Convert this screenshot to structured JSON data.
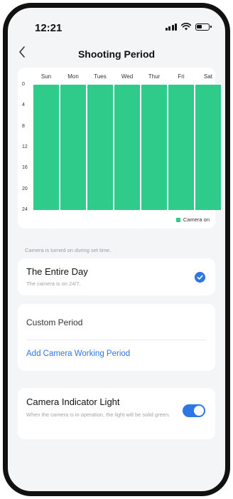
{
  "status_bar": {
    "time": "12:21",
    "icons": [
      "signal-icon",
      "wifi-icon",
      "battery-icon"
    ]
  },
  "header": {
    "title": "Shooting Period",
    "back_icon": "chevron-left-icon"
  },
  "schedule_chart": {
    "days": [
      "Sun",
      "Mon",
      "Tues",
      "Wed",
      "Thur",
      "Fri",
      "Sat"
    ],
    "hour_ticks": [
      "0",
      "4",
      "8",
      "12",
      "16",
      "20",
      "24"
    ],
    "legend_label": "Camera on",
    "bar_color": "#2ecb8a",
    "periods": [
      {
        "day": "Sun",
        "start": 0,
        "end": 24
      },
      {
        "day": "Mon",
        "start": 0,
        "end": 24
      },
      {
        "day": "Tues",
        "start": 0,
        "end": 24
      },
      {
        "day": "Wed",
        "start": 0,
        "end": 24
      },
      {
        "day": "Thur",
        "start": 0,
        "end": 24
      },
      {
        "day": "Fri",
        "start": 0,
        "end": 24
      },
      {
        "day": "Sat",
        "start": 0,
        "end": 24
      }
    ]
  },
  "hint_text": "Camera is turned on during set time.",
  "entire_day": {
    "title": "The Entire Day",
    "subtitle": "The camera is on 24/7.",
    "selected": true
  },
  "custom_period": {
    "title": "Custom Period",
    "add_link": "Add Camera Working Period"
  },
  "indicator_light": {
    "title": "Camera Indicator Light",
    "subtitle": "When the camera is in operation, the light will be solid green.",
    "enabled": true
  },
  "colors": {
    "accent": "#2f76e5",
    "camera_on": "#2ecb8a",
    "background": "#f4f5f7"
  }
}
